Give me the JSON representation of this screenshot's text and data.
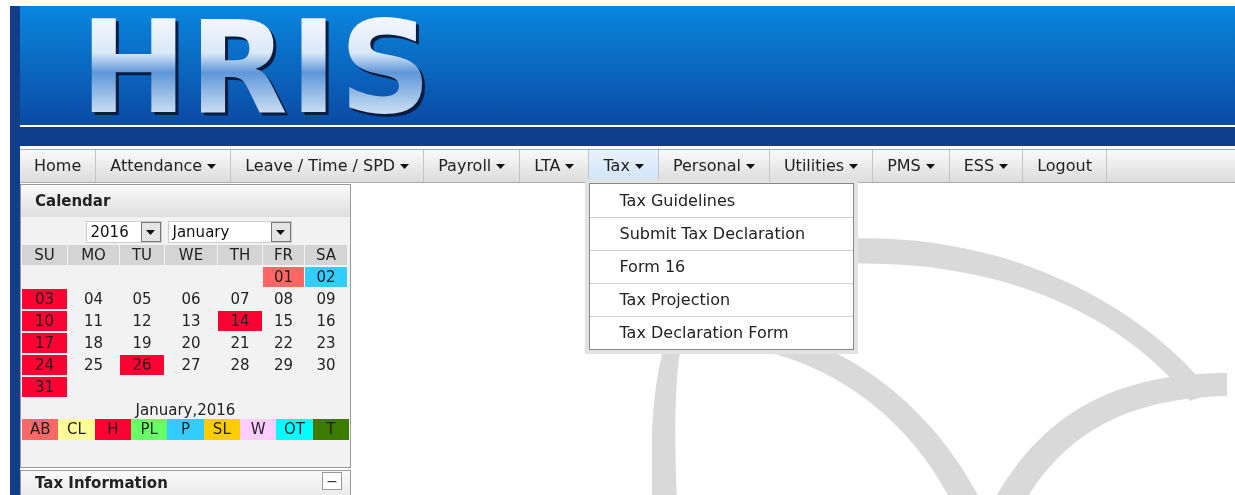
{
  "header": {
    "logo": "HRIS"
  },
  "nav": [
    {
      "label": "Home",
      "has_menu": false,
      "selected": false
    },
    {
      "label": "Attendance",
      "has_menu": true,
      "selected": false
    },
    {
      "label": "Leave / Time / SPD",
      "has_menu": true,
      "selected": false
    },
    {
      "label": "Payroll",
      "has_menu": true,
      "selected": false
    },
    {
      "label": "LTA",
      "has_menu": true,
      "selected": false
    },
    {
      "label": "Tax",
      "has_menu": true,
      "selected": true,
      "menu": [
        "Tax Guidelines",
        "Submit Tax Declaration",
        "Form 16",
        "Tax Projection",
        "Tax Declaration Form"
      ]
    },
    {
      "label": "Personal",
      "has_menu": true,
      "selected": false
    },
    {
      "label": "Utilities",
      "has_menu": true,
      "selected": false
    },
    {
      "label": "PMS",
      "has_menu": true,
      "selected": false
    },
    {
      "label": "ESS",
      "has_menu": true,
      "selected": false
    },
    {
      "label": "Logout",
      "has_menu": false,
      "selected": false
    }
  ],
  "calendar": {
    "title": "Calendar",
    "year": "2016",
    "month": "January",
    "weekdays": [
      "SU",
      "MO",
      "TU",
      "WE",
      "TH",
      "FR",
      "SA"
    ],
    "weeks": [
      [
        {
          "kind": "blank"
        },
        {
          "kind": "blank"
        },
        {
          "kind": "blank"
        },
        {
          "kind": "blank"
        },
        {
          "kind": "blank"
        },
        {
          "kind": "day",
          "day": "01",
          "color": "#ff6666"
        },
        {
          "kind": "day",
          "day": "02",
          "color": "#33ccff"
        }
      ],
      [
        {
          "kind": "day",
          "day": "03",
          "color": "#ff0033"
        },
        {
          "kind": "day",
          "day": "04"
        },
        {
          "kind": "day",
          "day": "05"
        },
        {
          "kind": "day",
          "day": "06"
        },
        {
          "kind": "day",
          "day": "07"
        },
        {
          "kind": "day",
          "day": "08"
        },
        {
          "kind": "day",
          "day": "09"
        }
      ],
      [
        {
          "kind": "day",
          "day": "10",
          "color": "#ff0033"
        },
        {
          "kind": "day",
          "day": "11"
        },
        {
          "kind": "day",
          "day": "12"
        },
        {
          "kind": "day",
          "day": "13"
        },
        {
          "kind": "day",
          "day": "14",
          "color": "#ff0033"
        },
        {
          "kind": "day",
          "day": "15"
        },
        {
          "kind": "day",
          "day": "16"
        }
      ],
      [
        {
          "kind": "day",
          "day": "17",
          "color": "#ff0033"
        },
        {
          "kind": "day",
          "day": "18"
        },
        {
          "kind": "day",
          "day": "19"
        },
        {
          "kind": "day",
          "day": "20"
        },
        {
          "kind": "day",
          "day": "21"
        },
        {
          "kind": "day",
          "day": "22"
        },
        {
          "kind": "day",
          "day": "23"
        }
      ],
      [
        {
          "kind": "day",
          "day": "24",
          "color": "#ff0033"
        },
        {
          "kind": "day",
          "day": "25"
        },
        {
          "kind": "day",
          "day": "26",
          "color": "#ff0033"
        },
        {
          "kind": "day",
          "day": "27"
        },
        {
          "kind": "day",
          "day": "28"
        },
        {
          "kind": "day",
          "day": "29"
        },
        {
          "kind": "day",
          "day": "30"
        }
      ],
      [
        {
          "kind": "day",
          "day": "31",
          "color": "#ff0033"
        },
        {
          "kind": "blank"
        },
        {
          "kind": "blank"
        },
        {
          "kind": "blank"
        },
        {
          "kind": "blank"
        },
        {
          "kind": "blank"
        },
        {
          "kind": "blank"
        }
      ]
    ],
    "caption": "January,2016",
    "legend": [
      {
        "label": "AB",
        "color": "#ff6666"
      },
      {
        "label": "CL",
        "color": "#ffff99"
      },
      {
        "label": "H",
        "color": "#ff0033"
      },
      {
        "label": "PL",
        "color": "#66ff66"
      },
      {
        "label": "P",
        "color": "#33ccff"
      },
      {
        "label": "SL",
        "color": "#ffcc00"
      },
      {
        "label": "W",
        "color": "#ffccff"
      },
      {
        "label": "OT",
        "color": "#00ffff"
      },
      {
        "label": "T",
        "color": "#3d7a00"
      }
    ]
  },
  "tax_panel": {
    "title": "Tax Information",
    "collapse": "−"
  }
}
